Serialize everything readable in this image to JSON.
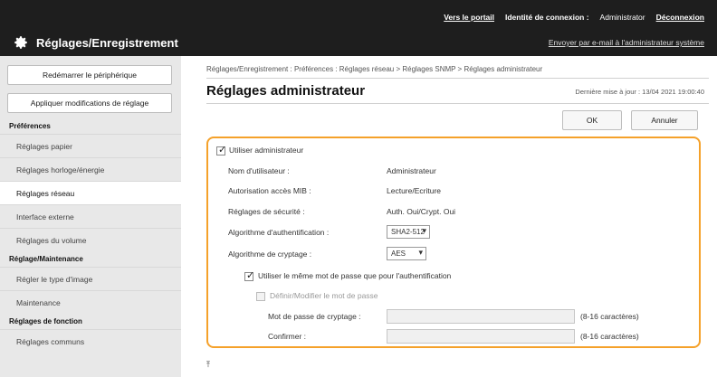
{
  "header": {
    "links": [
      "Vers le portail",
      "Identité de connexion :",
      "Administrator",
      "Déconnexion"
    ],
    "title": "Réglages/Enregistrement",
    "email_link": "Envoyer par e-mail à l'administrateur système"
  },
  "sidebar": {
    "buttons": [
      "Redémarrer le périphérique",
      "Appliquer modifications de réglage"
    ],
    "sections": [
      {
        "heading": "Préférences",
        "items": [
          "Réglages papier",
          "Réglages horloge/énergie",
          "Réglages réseau",
          "Interface externe",
          "Réglages du volume"
        ]
      },
      {
        "heading": "Réglage/Maintenance",
        "items": [
          "Régler le type d'image",
          "Maintenance"
        ]
      },
      {
        "heading": "Réglages de fonction",
        "items": [
          "Réglages communs"
        ]
      }
    ],
    "active_item": "Réglages réseau"
  },
  "main": {
    "breadcrumb": "Réglages/Enregistrement : Préférences : Réglages réseau > Réglages SNMP > Réglages administrateur",
    "title": "Réglages administrateur",
    "last_updated": "Dernière mise à jour : 13/04 2021 19:00:40",
    "ok_label": "OK",
    "cancel_label": "Annuler",
    "use_admin_label": "Utiliser administrateur",
    "fields": {
      "username_label": "Nom d'utilisateur :",
      "username_value": "Administrateur",
      "mib_label": "Autorisation accès MIB :",
      "mib_value": "Lecture/Ecriture",
      "security_label": "Réglages de sécurité :",
      "security_value": "Auth. Oui/Crypt. Oui",
      "auth_algo_label": "Algorithme d'authentification :",
      "auth_algo_value": "SHA2-512",
      "crypt_algo_label": "Algorithme de cryptage :",
      "crypt_algo_value": "AES"
    },
    "same_password_label": "Utiliser le même mot de passe que pour l'authentification",
    "set_password_label": "Définir/Modifier le mot de passe",
    "crypt_password_label": "Mot de passe de cryptage :",
    "crypt_password_hint": "(8-16 caractères)",
    "confirm_label": "Confirmer :",
    "confirm_hint": "(8-16 caractères)"
  },
  "colors": {
    "highlight": "#f5a12a",
    "header_bg": "#1e1e1e"
  },
  "icons": {
    "settings": "gear-icon",
    "dropdown": "chevron-down-icon",
    "top": "arrow-to-top-icon"
  },
  "state": {
    "use_admin": true,
    "same_password": true,
    "set_password": false
  }
}
